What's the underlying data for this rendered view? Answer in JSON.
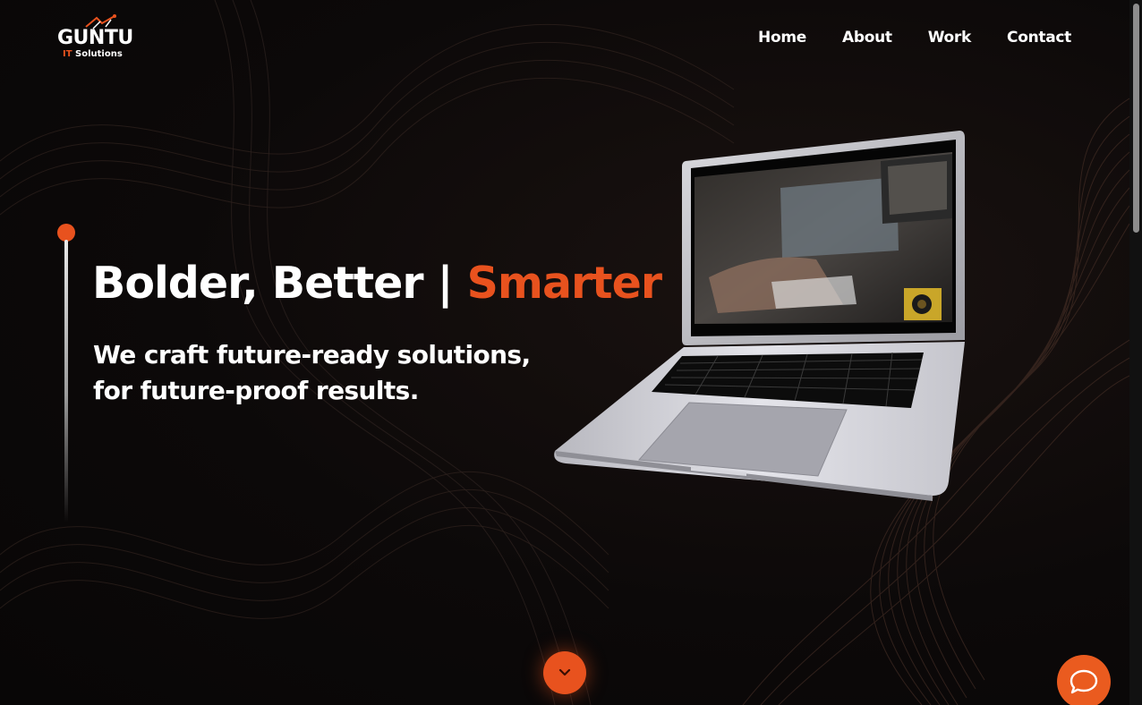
{
  "brand": {
    "name": "GUNTU",
    "tagline_accent": "IT",
    "tagline_rest": "Solutions"
  },
  "nav": {
    "items": [
      {
        "label": "Home"
      },
      {
        "label": "About"
      },
      {
        "label": "Work"
      },
      {
        "label": "Contact"
      }
    ]
  },
  "hero": {
    "headline_main": "Bolder, Better | ",
    "headline_accent": "Smarter",
    "subline_1": "We craft future-ready solutions,",
    "subline_2": "for future-proof results."
  },
  "colors": {
    "accent": "#e8521e",
    "background": "#0b0808",
    "text": "#ffffff"
  },
  "icons": {
    "scroll": "chevron-down-icon",
    "chat": "chat-bubble-icon"
  }
}
